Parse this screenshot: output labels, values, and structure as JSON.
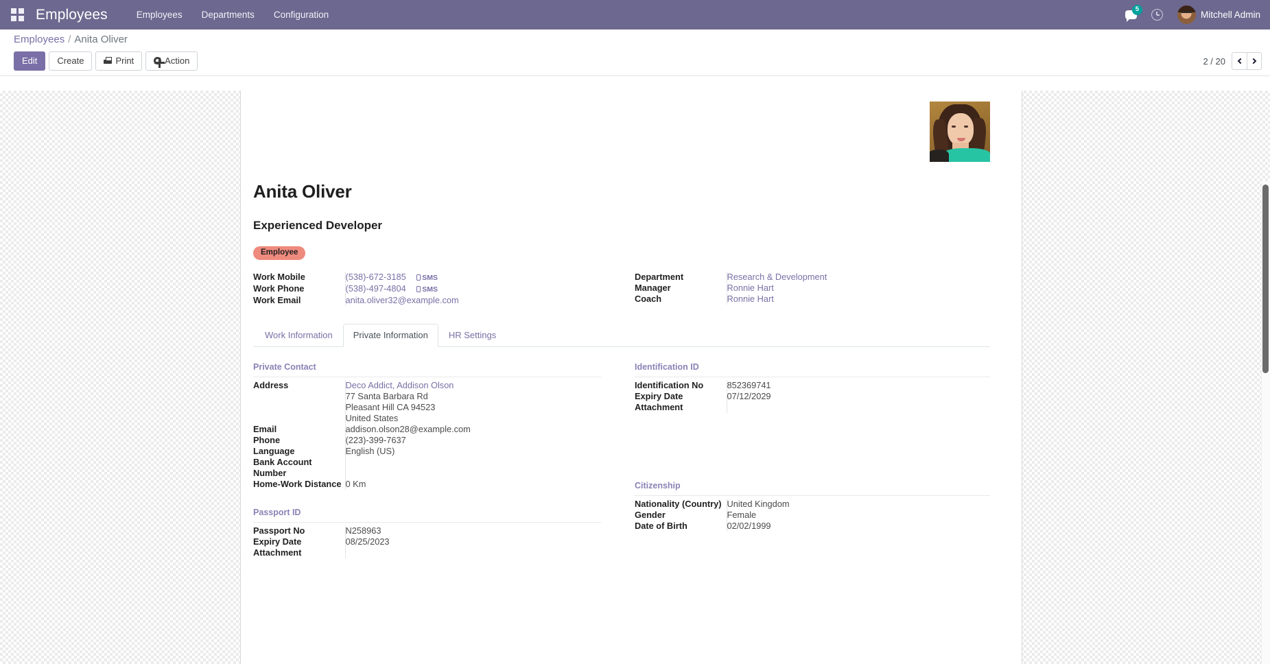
{
  "navbar": {
    "apps_icon": "apps-grid-icon",
    "brand": "Employees",
    "menu": [
      {
        "label": "Employees"
      },
      {
        "label": "Departments"
      },
      {
        "label": "Configuration"
      }
    ],
    "messages_icon": "messages-icon",
    "messages_count": "5",
    "activities_icon": "clock-icon",
    "user_name": "Mitchell Admin",
    "brand_color": "#6d688f"
  },
  "control_panel": {
    "breadcrumb_root": "Employees",
    "breadcrumb_sep": "/",
    "breadcrumb_current": "Anita Oliver",
    "buttons": {
      "edit": "Edit",
      "create": "Create",
      "print": "Print",
      "action": "Action"
    },
    "pager": {
      "counter": "2 / 20",
      "prev_icon": "chevron-left-icon",
      "next_icon": "chevron-right-icon"
    }
  },
  "record": {
    "photo_alt": "employee-photo",
    "name": "Anita Oliver",
    "job_title": "Experienced Developer",
    "tag": "Employee",
    "header_left": [
      {
        "label": "Work Mobile",
        "value": "(538)-672-3185",
        "sms": "SMS",
        "link": true
      },
      {
        "label": "Work Phone",
        "value": "(538)-497-4804",
        "sms": "SMS",
        "link": true
      },
      {
        "label": "Work Email",
        "value": "anita.oliver32@example.com",
        "sms": "",
        "link": true
      }
    ],
    "header_right": [
      {
        "label": "Department",
        "value": "Research & Development",
        "link": true
      },
      {
        "label": "Manager",
        "value": "Ronnie Hart",
        "link": true
      },
      {
        "label": "Coach",
        "value": "Ronnie Hart",
        "link": true
      }
    ]
  },
  "tabs": [
    {
      "label": "Work Information",
      "active": false
    },
    {
      "label": "Private Information",
      "active": true
    },
    {
      "label": "HR Settings",
      "active": false
    }
  ],
  "private_information": {
    "private_contact": {
      "title": "Private Contact",
      "address_label": "Address",
      "address_company": "Deco Addict, Addison Olson",
      "address_street": "77 Santa Barbara Rd",
      "address_city": "Pleasant Hill CA 94523",
      "address_country": "United States",
      "email_label": "Email",
      "email": "addison.olson28@example.com",
      "phone_label": "Phone",
      "phone": "(223)-399-7637",
      "language_label": "Language",
      "language": "English (US)",
      "bank_label": "Bank Account Number",
      "bank_value": "",
      "distance_label": "Home-Work Distance",
      "distance_value": "0  Km"
    },
    "identification_id": {
      "title": "Identification ID",
      "id_no_label": "Identification No",
      "id_no": "852369741",
      "expiry_label": "Expiry Date",
      "expiry": "07/12/2029",
      "attachment_label": "Attachment",
      "attachment": ""
    },
    "passport_id": {
      "title": "Passport ID",
      "passport_no_label": "Passport No",
      "passport_no": "N258963",
      "expiry_label": "Expiry Date",
      "expiry": "08/25/2023",
      "attachment_label": "Attachment",
      "attachment": ""
    },
    "citizenship": {
      "title": "Citizenship",
      "nationality_label": "Nationality (Country)",
      "nationality": "United Kingdom",
      "gender_label": "Gender",
      "gender": "Female",
      "dob_label": "Date of Birth",
      "dob": "02/02/1999"
    }
  },
  "colors": {
    "brand_purple": "#6d688f",
    "link_purple": "#7a6fa6",
    "tag_salmon": "#ef8a7e",
    "badge_teal": "#00a09d"
  }
}
